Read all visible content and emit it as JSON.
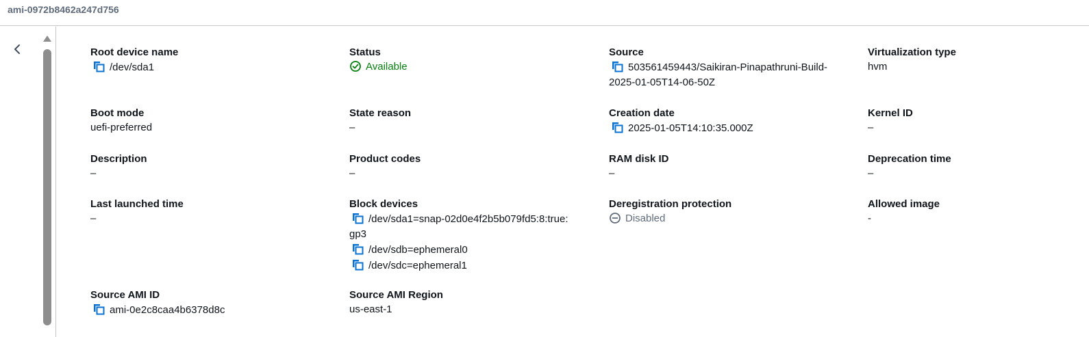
{
  "header": {
    "ami_id": "ami-0972b8462a247d756"
  },
  "fields": {
    "root_device_name": {
      "label": "Root device name",
      "value": "/dev/sda1"
    },
    "status": {
      "label": "Status",
      "value": "Available",
      "color": "#037f0c",
      "icon": "check-circle-icon"
    },
    "source": {
      "label": "Source",
      "value_line1": "503561459443/Saikiran-Pinapathruni-Build-",
      "value_line2": "2025-01-05T14-06-50Z"
    },
    "virtualization_type": {
      "label": "Virtualization type",
      "value": "hvm"
    },
    "boot_mode": {
      "label": "Boot mode",
      "value": "uefi-preferred"
    },
    "state_reason": {
      "label": "State reason",
      "value": "–"
    },
    "creation_date": {
      "label": "Creation date",
      "value": "2025-01-05T14:10:35.000Z"
    },
    "kernel_id": {
      "label": "Kernel ID",
      "value": "–"
    },
    "description": {
      "label": "Description",
      "value": "–"
    },
    "product_codes": {
      "label": "Product codes",
      "value": "–"
    },
    "ram_disk_id": {
      "label": "RAM disk ID",
      "value": "–"
    },
    "deprecation_time": {
      "label": "Deprecation time",
      "value": "–"
    },
    "last_launched_time": {
      "label": "Last launched time",
      "value": "–"
    },
    "block_devices": {
      "label": "Block devices",
      "items": [
        "/dev/sda1=snap-02d0e4f2b5b079fd5:8:true:",
        "gp3",
        "/dev/sdb=ephemeral0",
        "/dev/sdc=ephemeral1"
      ]
    },
    "deregistration_protection": {
      "label": "Deregistration protection",
      "value": "Disabled",
      "icon": "minus-circle-icon"
    },
    "allowed_image": {
      "label": "Allowed image",
      "value": "-"
    },
    "source_ami_id": {
      "label": "Source AMI ID",
      "value": "ami-0e2c8caa4b6378d8c"
    },
    "source_ami_region": {
      "label": "Source AMI Region",
      "value": "us-east-1"
    }
  },
  "colors": {
    "accent": "#0972d3",
    "success": "#037f0c",
    "muted": "#5f6b7a"
  },
  "icons": {
    "copy": "copy-icon",
    "collapse": "chevron-left-icon",
    "scroll_up": "triangle-up-icon"
  }
}
